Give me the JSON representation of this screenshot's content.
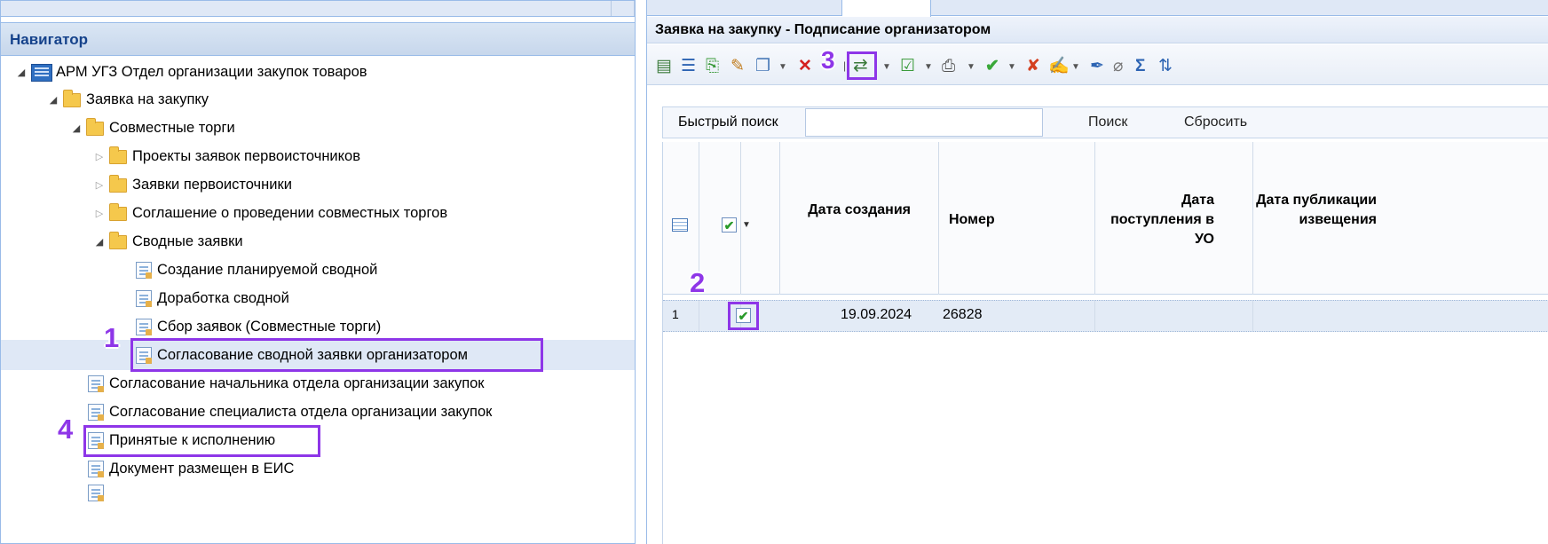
{
  "navigator": {
    "title": "Навигатор",
    "tree": [
      {
        "label": "АРМ УГЗ Отдел организации закупок товаров"
      },
      {
        "label": "Заявка на закупку"
      },
      {
        "label": "Совместные торги"
      },
      {
        "label": "Проекты заявок первоисточников"
      },
      {
        "label": "Заявки первоисточники"
      },
      {
        "label": "Соглашение о проведении совместных торгов"
      },
      {
        "label": "Сводные заявки"
      },
      {
        "label": "Создание планируемой сводной"
      },
      {
        "label": "Доработка сводной"
      },
      {
        "label": "Сбор заявок (Совместные торги)"
      },
      {
        "label": "Согласование сводной заявки организатором"
      },
      {
        "label": "Согласование начальника отдела организации закупок"
      },
      {
        "label": "Согласование специалиста отдела организации закупок"
      },
      {
        "label": "Принятые к исполнению"
      },
      {
        "label": "Документ размещен в ЕИС"
      }
    ]
  },
  "main": {
    "title": "Заявка на закупку - Подписание организатором",
    "search": {
      "label": "Быстрый поиск",
      "value": "",
      "find_label": "Поиск",
      "reset_label": "Сбросить"
    },
    "columns": {
      "date_created": "Дата создания",
      "number": "Номер",
      "date_received": "Дата поступления в УО",
      "date_published": "Дата публикации извещения"
    },
    "rows": [
      {
        "index": "1",
        "date_created": "19.09.2024",
        "number": "26828"
      }
    ]
  },
  "annotations": {
    "step1": "1",
    "step2": "2",
    "step3": "3",
    "step4": "4",
    "color": "#8e36e8"
  },
  "icons": [
    "list-icon",
    "numbered-list-icon",
    "export-icon",
    "edit-icon",
    "copy-icon",
    "delete-icon",
    "route-icon",
    "approve-doc-icon",
    "print-icon",
    "check-icon",
    "reject-icon",
    "doc-action-icon",
    "sign-icon",
    "attach-icon",
    "sum-icon",
    "sort-icon"
  ]
}
